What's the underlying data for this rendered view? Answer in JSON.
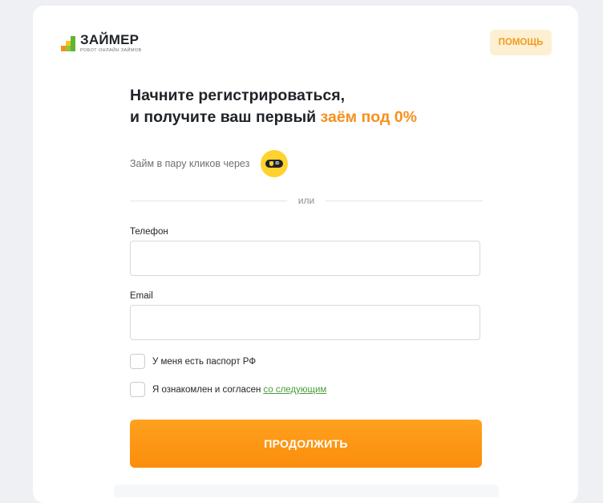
{
  "brand": {
    "name": "ЗАЙМЕР",
    "tagline": "РОБОТ ОНЛАЙН ЗАЙМОВ",
    "colors": {
      "green": "#5fb531",
      "orange": "#f7901e",
      "yellow": "#ffd22d"
    }
  },
  "header": {
    "help_label": "ПОМОЩЬ"
  },
  "headline": {
    "line1": "Начните регистрироваться,",
    "line2_prefix": "и получите ваш первый ",
    "line2_accent": "заём под 0%"
  },
  "quick_login": {
    "text": "Займ в пару кликов через",
    "badge_text": "ID",
    "icon": "id-logo-icon"
  },
  "divider_text": "или",
  "form": {
    "phone": {
      "label": "Телефон",
      "value": "",
      "placeholder": ""
    },
    "email": {
      "label": "Email",
      "value": "",
      "placeholder": ""
    },
    "passport": {
      "label": "У меня есть паспорт РФ",
      "checked": false
    },
    "agreement": {
      "label": "Я ознакомлен и согласен",
      "link": "со следующим",
      "checked": false
    },
    "submit_label": "ПРОДОЛЖИТЬ"
  }
}
